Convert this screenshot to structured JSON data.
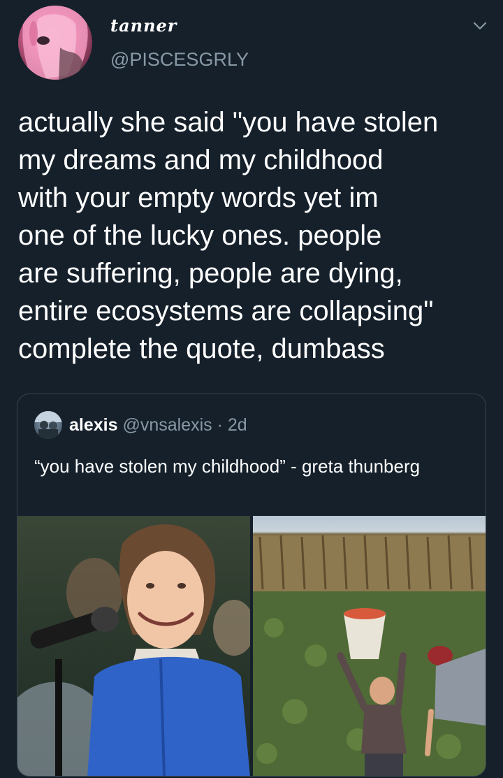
{
  "tweet": {
    "display_name": "tanner",
    "handle": "@PISCESGRLY",
    "text": "actually she said \"you have stolen\nmy dreams and my childhood\nwith your empty words yet im\none of the lucky ones. people\nare suffering, people are dying,\nentire ecosystems are collapsing\"\ncomplete the quote, dumbass"
  },
  "quoted": {
    "name": "alexis",
    "handle": "@vnsalexis",
    "separator": "·",
    "time": "2d",
    "text": "“you have stolen my childhood” - greta thunberg"
  },
  "icons": {
    "menu": "chevron-down-icon",
    "avatar": "profile-avatar",
    "quoted_avatar": "quoted-profile-avatar"
  },
  "colors": {
    "background": "#15202b",
    "secondary_text": "#8899a6",
    "border": "#38444d"
  },
  "media": [
    {
      "kind": "photo",
      "name": "photo-girl-at-microphone"
    },
    {
      "kind": "photo",
      "name": "photo-child-laborer-in-field"
    }
  ]
}
